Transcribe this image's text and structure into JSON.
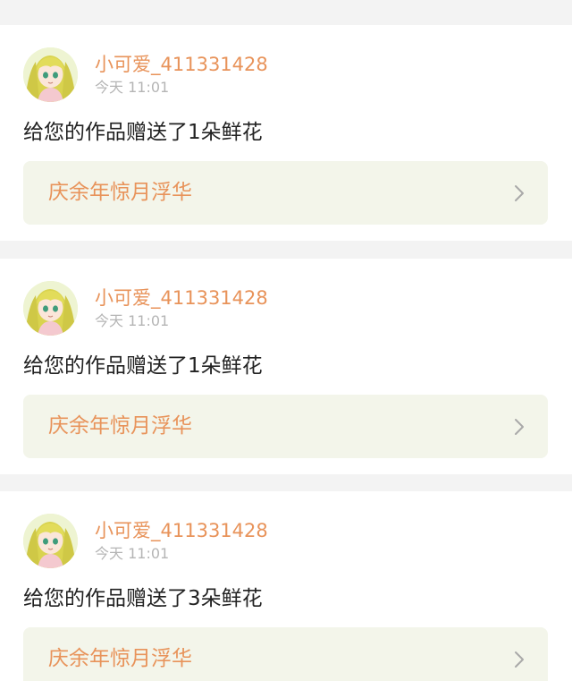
{
  "feed": {
    "items": [
      {
        "username": "小可爱_411331428",
        "time": "今天 11:01",
        "message": "给您的作品赠送了1朵鲜花",
        "work_title": "庆余年惊月浮华"
      },
      {
        "username": "小可爱_411331428",
        "time": "今天 11:01",
        "message": "给您的作品赠送了1朵鲜花",
        "work_title": "庆余年惊月浮华"
      },
      {
        "username": "小可爱_411331428",
        "time": "今天 11:01",
        "message": "给您的作品赠送了3朵鲜花",
        "work_title": "庆余年惊月浮华"
      }
    ]
  },
  "icons": {
    "avatar": "anime-girl-avatar",
    "chevron": "chevron-right-icon"
  },
  "colors": {
    "accent_orange": "#e8935a",
    "link_background": "#f3f5ea",
    "time_gray": "#b5b5b5",
    "page_background": "#f3f3f3"
  }
}
